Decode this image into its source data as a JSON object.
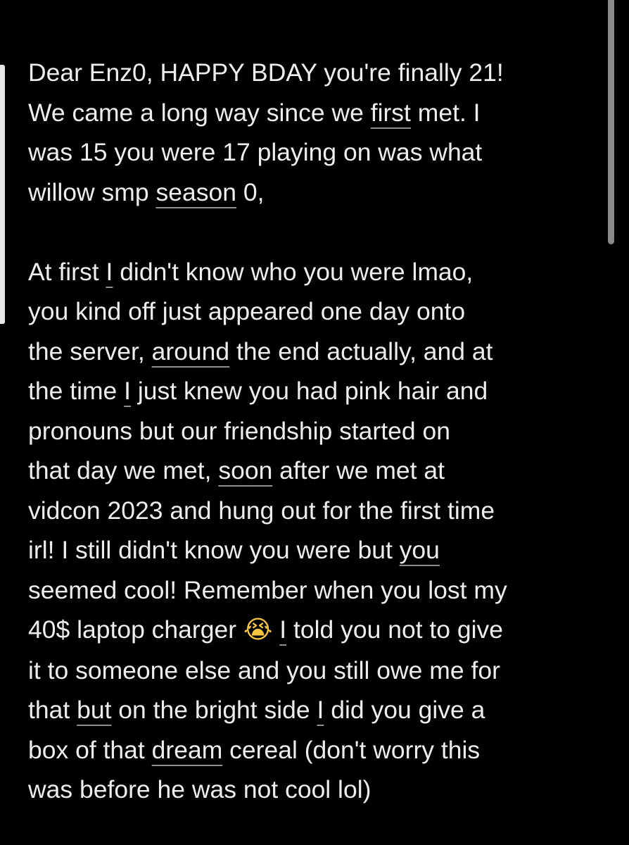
{
  "ui": {
    "background": "#000000",
    "text_color": "#ededed",
    "underline_color": "#8f8f8f",
    "scrollbar_color": "#8a8a8a",
    "cursor_bar_color": "#e6e6e6"
  },
  "note": {
    "paragraphs": [
      {
        "lines": [
          [
            {
              "t": "Dear Enz0, HAPPY BDAY you're finally 21!"
            }
          ],
          [
            {
              "t": "We came a long way since we "
            },
            {
              "t": "first",
              "u": true
            },
            {
              "t": " met. I"
            }
          ],
          [
            {
              "t": "was 15 you were 17 playing on was what"
            }
          ],
          [
            {
              "t": "willow smp "
            },
            {
              "t": "season",
              "u": true
            },
            {
              "t": " 0,"
            }
          ]
        ]
      },
      {
        "lines": [
          [
            {
              "t": "At first "
            },
            {
              "t": "I",
              "u": true
            },
            {
              "t": " didn't know who you were lmao,"
            }
          ],
          [
            {
              "t": "you kind off just appeared one day onto"
            }
          ],
          [
            {
              "t": "the server, "
            },
            {
              "t": "around",
              "u": true
            },
            {
              "t": " the end actually, and at"
            }
          ],
          [
            {
              "t": "the time "
            },
            {
              "t": "I",
              "u": true
            },
            {
              "t": " just knew you had pink hair and"
            }
          ],
          [
            {
              "t": "pronouns but our friendship started on"
            }
          ],
          [
            {
              "t": "that day we met, "
            },
            {
              "t": "soon",
              "u": true
            },
            {
              "t": " after we met at"
            }
          ],
          [
            {
              "t": "vidcon 2023 and hung out for the first time"
            }
          ],
          [
            {
              "t": "irl! I still didn't know you were but "
            },
            {
              "t": "you",
              "u": true
            }
          ],
          [
            {
              "t": "seemed cool! Remember when you lost my"
            }
          ],
          [
            {
              "t": "40$ laptop charger "
            },
            {
              "t": "😭",
              "emoji": "loudly-crying-face-icon"
            },
            {
              "t": " "
            },
            {
              "t": "I",
              "u": true
            },
            {
              "t": " told you not to give"
            }
          ],
          [
            {
              "t": "it to someone else and you still owe me for"
            }
          ],
          [
            {
              "t": "that "
            },
            {
              "t": "but",
              "u": true
            },
            {
              "t": " on the bright side "
            },
            {
              "t": "I",
              "u": true
            },
            {
              "t": " did you give a"
            }
          ],
          [
            {
              "t": "box of that "
            },
            {
              "t": "dream",
              "u": true
            },
            {
              "t": " cereal (don't worry this"
            }
          ],
          [
            {
              "t": "was before he was not cool lol)"
            }
          ]
        ]
      }
    ]
  }
}
